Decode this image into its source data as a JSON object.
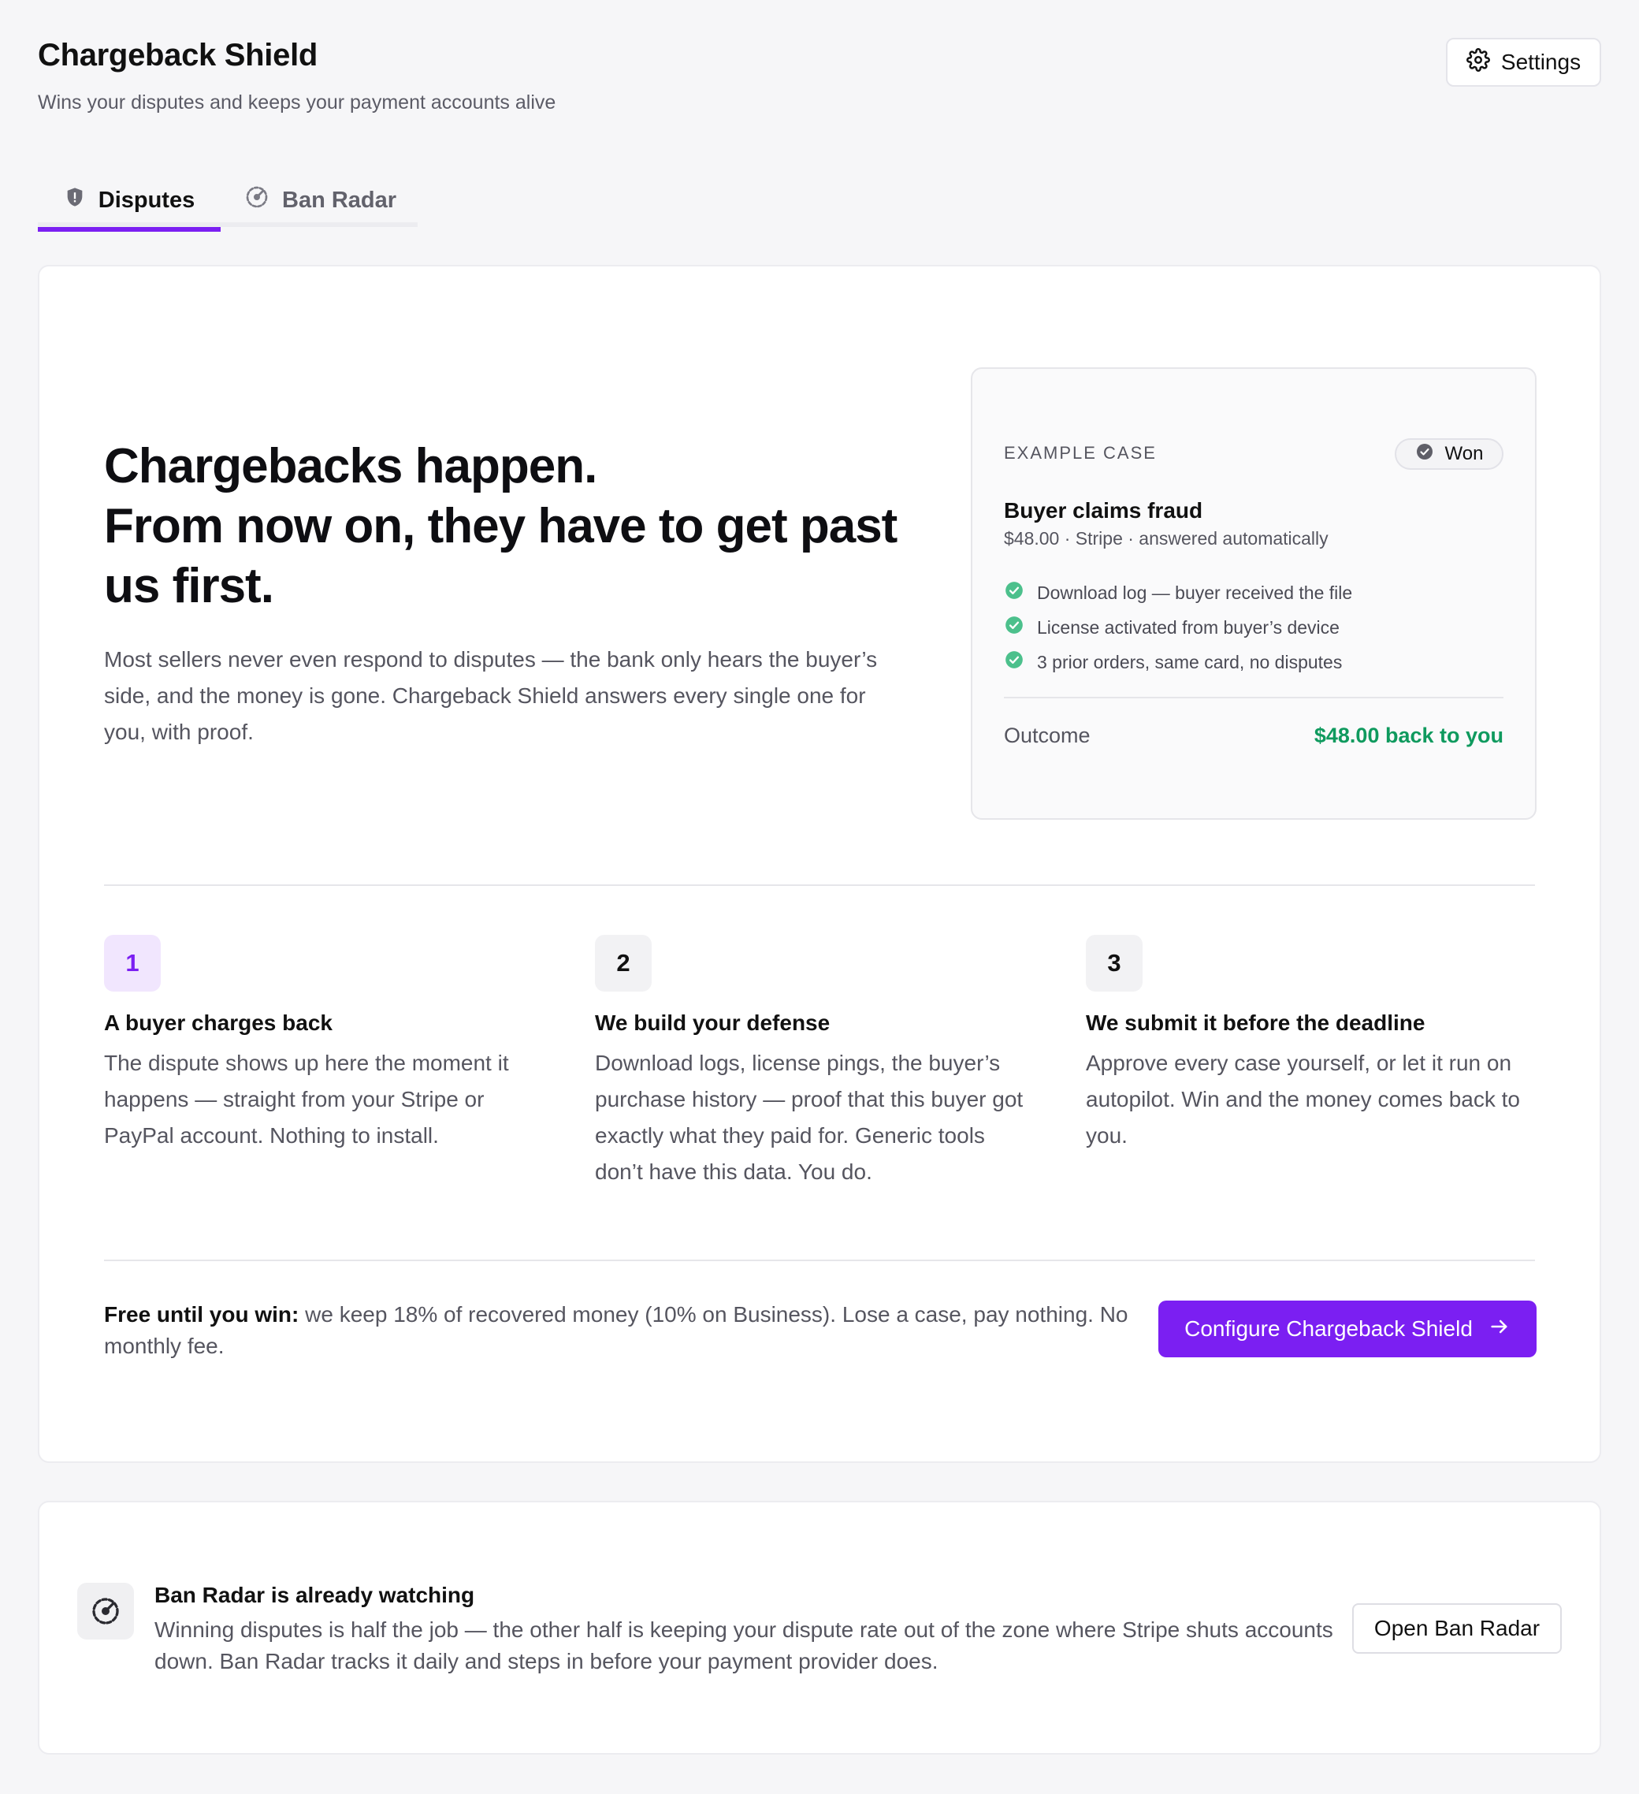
{
  "header": {
    "title": "Chargeback Shield",
    "subtitle": "Wins your disputes and keeps your payment accounts alive",
    "settings_label": "Settings"
  },
  "tabs": [
    {
      "label": "Disputes",
      "icon": "shield-alert-icon",
      "active": true
    },
    {
      "label": "Ban Radar",
      "icon": "radar-icon",
      "active": false
    }
  ],
  "hero": {
    "title_line1": "Chargebacks happen.",
    "title_line2": "From now on, they have to get past us first.",
    "body": "Most sellers never even respond to disputes — the bank only hears the buyer’s side, and the money is gone. Chargeback Shield answers every single one for you, with proof."
  },
  "example_case": {
    "label": "EXAMPLE CASE",
    "status": "Won",
    "title": "Buyer claims fraud",
    "meta": "$48.00 · Stripe · answered automatically",
    "evidence": [
      "Download log — buyer received the file",
      "License activated from buyer’s device",
      "3 prior orders, same card, no disputes"
    ],
    "outcome_label": "Outcome",
    "outcome_value": "$48.00 back to you"
  },
  "steps": [
    {
      "number": "1",
      "title": "A buyer charges back",
      "body": "The dispute shows up here the moment it happens — straight from your Stripe or PayPal account. Nothing to install."
    },
    {
      "number": "2",
      "title": "We build your defense",
      "body": "Download logs, license pings, the buyer’s purchase history — proof that this buyer got exactly what they paid for. Generic tools don’t have this data. You do."
    },
    {
      "number": "3",
      "title": "We submit it before the deadline",
      "body": "Approve every case yourself, or let it run on autopilot. Win and the money comes back to you."
    }
  ],
  "pricing": {
    "lead": "Free until you win:",
    "text": " we keep 18% of recovered money (10% on Business). Lose a case, pay nothing. No monthly fee."
  },
  "cta_label": "Configure Chargeback Shield",
  "ban_radar": {
    "title": "Ban Radar is already watching",
    "body": "Winning disputes is half the job — the other half is keeping your dispute rate out of the zone where Stripe shuts accounts down. Ban Radar tracks it daily and steps in before your payment provider does.",
    "button_label": "Open Ban Radar"
  },
  "colors": {
    "accent": "#7b1ff2",
    "success": "#0f9a5e",
    "check": "#4cc08c"
  }
}
